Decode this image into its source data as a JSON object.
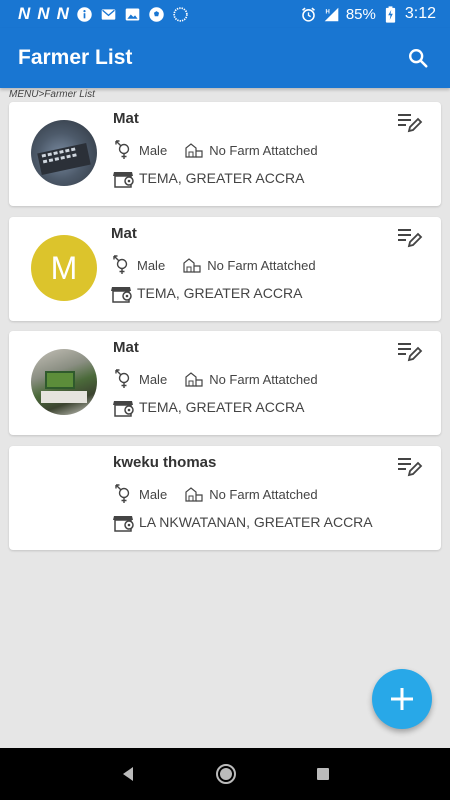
{
  "status_bar": {
    "left_icons": [
      "N",
      "N",
      "N"
    ],
    "battery": "85%",
    "time": "3:12"
  },
  "app_bar": {
    "title": "Farmer List"
  },
  "breadcrumb": "MENU>Farmer List",
  "farmers": [
    {
      "name": "Mat",
      "gender": "Male",
      "farm": "No Farm Attatched",
      "location": "TEMA, GREATER ACCRA",
      "avatar": "photo"
    },
    {
      "name": "Mat",
      "gender": "Male",
      "farm": "No Farm Attatched",
      "location": "TEMA, GREATER ACCRA",
      "avatar_letter": "M"
    },
    {
      "name": "Mat",
      "gender": "Male",
      "farm": "No Farm Attatched",
      "location": "TEMA, GREATER ACCRA",
      "avatar": "photo"
    },
    {
      "name": "kweku thomas",
      "gender": "Male",
      "farm": "No Farm Attatched",
      "location": "LA NKWATANAN, GREATER ACCRA",
      "avatar": "none"
    }
  ],
  "colors": {
    "primary": "#1976d2",
    "fab": "#28a8e8",
    "avatar_letter_bg": "#dcc42c"
  },
  "icons": {
    "search": "search-icon",
    "edit": "edit-list-icon",
    "gender": "gender-icon",
    "farm": "farm-icon",
    "location": "store-location-icon",
    "add": "plus-icon"
  }
}
